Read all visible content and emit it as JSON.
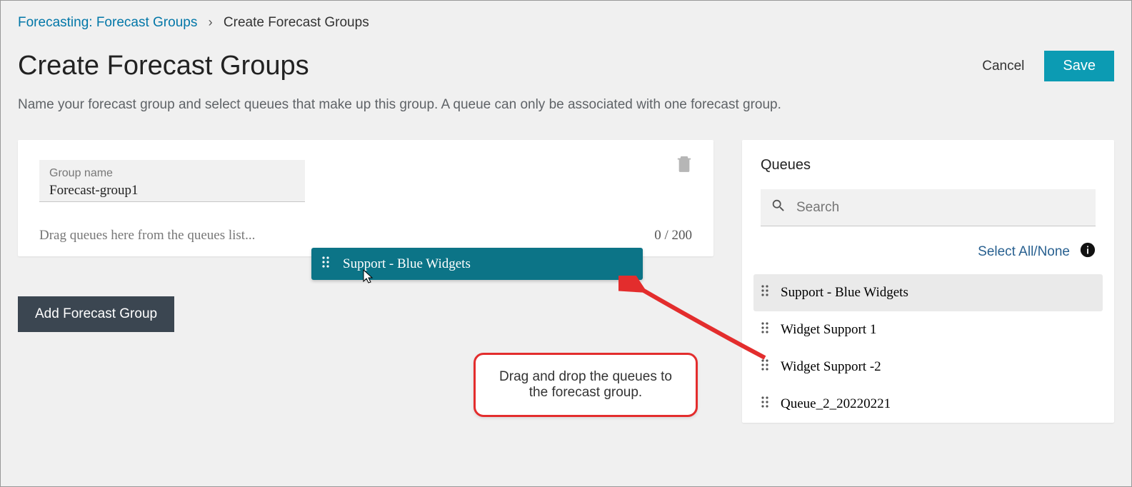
{
  "breadcrumb": {
    "parent": "Forecasting: Forecast Groups",
    "current": "Create Forecast Groups"
  },
  "page": {
    "title": "Create Forecast Groups",
    "cancel": "Cancel",
    "save": "Save",
    "description": "Name your forecast group and select queues that make up this group. A queue can only be associated with one forecast group."
  },
  "group": {
    "name_label": "Group name",
    "name_value": "Forecast-group1",
    "drop_hint": "Drag queues here from the queues list...",
    "counter": "0 / 200",
    "dragging_item": "Support - Blue Widgets"
  },
  "add_button": "Add Forecast Group",
  "tooltip": "Drag and drop the queues to the forecast group.",
  "queues_panel": {
    "title": "Queues",
    "search_placeholder": "Search",
    "select_all": "Select All/None",
    "items": [
      "Support - Blue Widgets",
      "Widget Support 1",
      "Widget Support -2",
      "Queue_2_20220221"
    ]
  }
}
